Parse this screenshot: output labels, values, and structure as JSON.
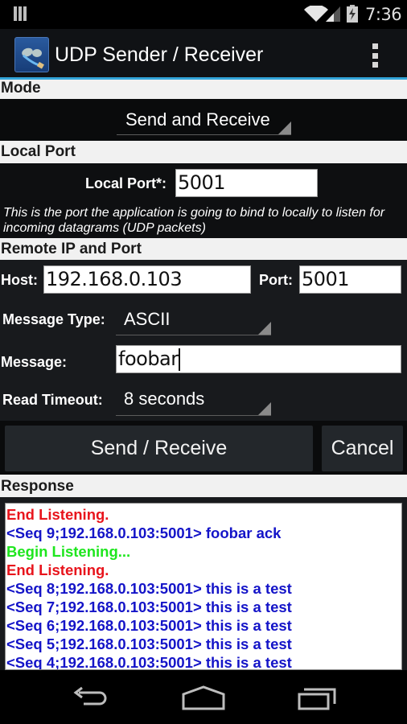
{
  "status_bar": {
    "time": "7:36",
    "icons": [
      "notification-icon",
      "wifi-icon",
      "signal-icon",
      "battery-charging-icon"
    ]
  },
  "action_bar": {
    "title": "UDP Sender / Receiver",
    "app_icon": "network-cable-icon",
    "overflow_icon": "overflow-menu-icon"
  },
  "sections": {
    "mode": "Mode",
    "local_port": "Local Port",
    "remote": "Remote IP and Port",
    "response": "Response"
  },
  "mode": {
    "selected": "Send and Receive"
  },
  "local_port": {
    "label": "Local Port*:",
    "value": "5001",
    "hint": "This is the port the application is going to bind to locally to listen for incoming datagrams (UDP packets)"
  },
  "remote": {
    "host_label": "Host:",
    "host_value": "192.168.0.103",
    "port_label": "Port:",
    "port_value": "5001",
    "message_type_label": "Message Type:",
    "message_type_selected": "ASCII",
    "message_label": "Message:",
    "message_value": "foobar",
    "read_timeout_label": "Read Timeout:",
    "read_timeout_selected": "8 seconds"
  },
  "buttons": {
    "send_receive": "Send / Receive",
    "cancel": "Cancel"
  },
  "colors": {
    "accent": "#33a5d9",
    "status_end": "#e8141c",
    "status_begin": "#1ee61e",
    "packet": "#1414c8"
  },
  "response": {
    "lines": [
      {
        "text": "End Listening.",
        "type": "end"
      },
      {
        "text": "<Seq 9;192.168.0.103:5001> foobar ack",
        "type": "packet"
      },
      {
        "text": "Begin Listening...",
        "type": "begin"
      },
      {
        "text": "End Listening.",
        "type": "end"
      },
      {
        "text": "<Seq 8;192.168.0.103:5001> this is a test",
        "type": "packet"
      },
      {
        "text": "<Seq 7;192.168.0.103:5001> this is a test",
        "type": "packet"
      },
      {
        "text": "<Seq 6;192.168.0.103:5001> this is a test",
        "type": "packet"
      },
      {
        "text": "<Seq 5;192.168.0.103:5001> this is a test",
        "type": "packet"
      },
      {
        "text": "<Seq 4;192.168.0.103:5001> this is a test",
        "type": "packet"
      }
    ]
  },
  "nav_bar": {
    "buttons": [
      "back-icon",
      "home-icon",
      "recents-icon"
    ]
  }
}
